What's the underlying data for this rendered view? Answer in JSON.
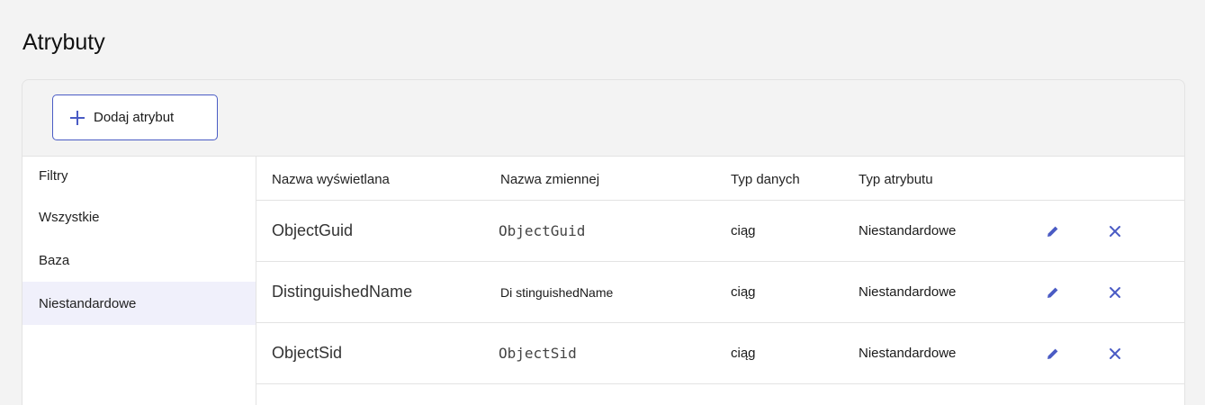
{
  "page": {
    "title": "Atrybuty"
  },
  "toolbar": {
    "add_label": "Dodaj atrybut"
  },
  "sidebar": {
    "heading": "Filtry",
    "items": [
      {
        "label": "Wszystkie",
        "active": false
      },
      {
        "label": "Baza",
        "active": false
      },
      {
        "label": "Niestandardowe",
        "active": true
      }
    ]
  },
  "table": {
    "columns": [
      "Nazwa wyświetlana",
      "Nazwa zmiennej",
      "Typ danych",
      "Typ atrybutu"
    ],
    "rows": [
      {
        "display_name": "ObjectGuid",
        "variable_name": "ObjectGuid",
        "data_type": "ciąg",
        "attribute_type": "Niestandardowe"
      },
      {
        "display_name": "DistinguishedName",
        "variable_name": "Di stinguishedName",
        "data_type": "ciąg",
        "attribute_type": "Niestandardowe"
      },
      {
        "display_name": "ObjectSid",
        "variable_name": "ObjectSid",
        "data_type": "ciąg",
        "attribute_type": "Niestandardowe"
      }
    ]
  },
  "colors": {
    "accent": "#4a5bc4",
    "active_filter_bg": "#f0f0fb"
  },
  "icons": {
    "add": "plus-icon",
    "edit": "pencil-icon",
    "delete": "close-icon"
  }
}
